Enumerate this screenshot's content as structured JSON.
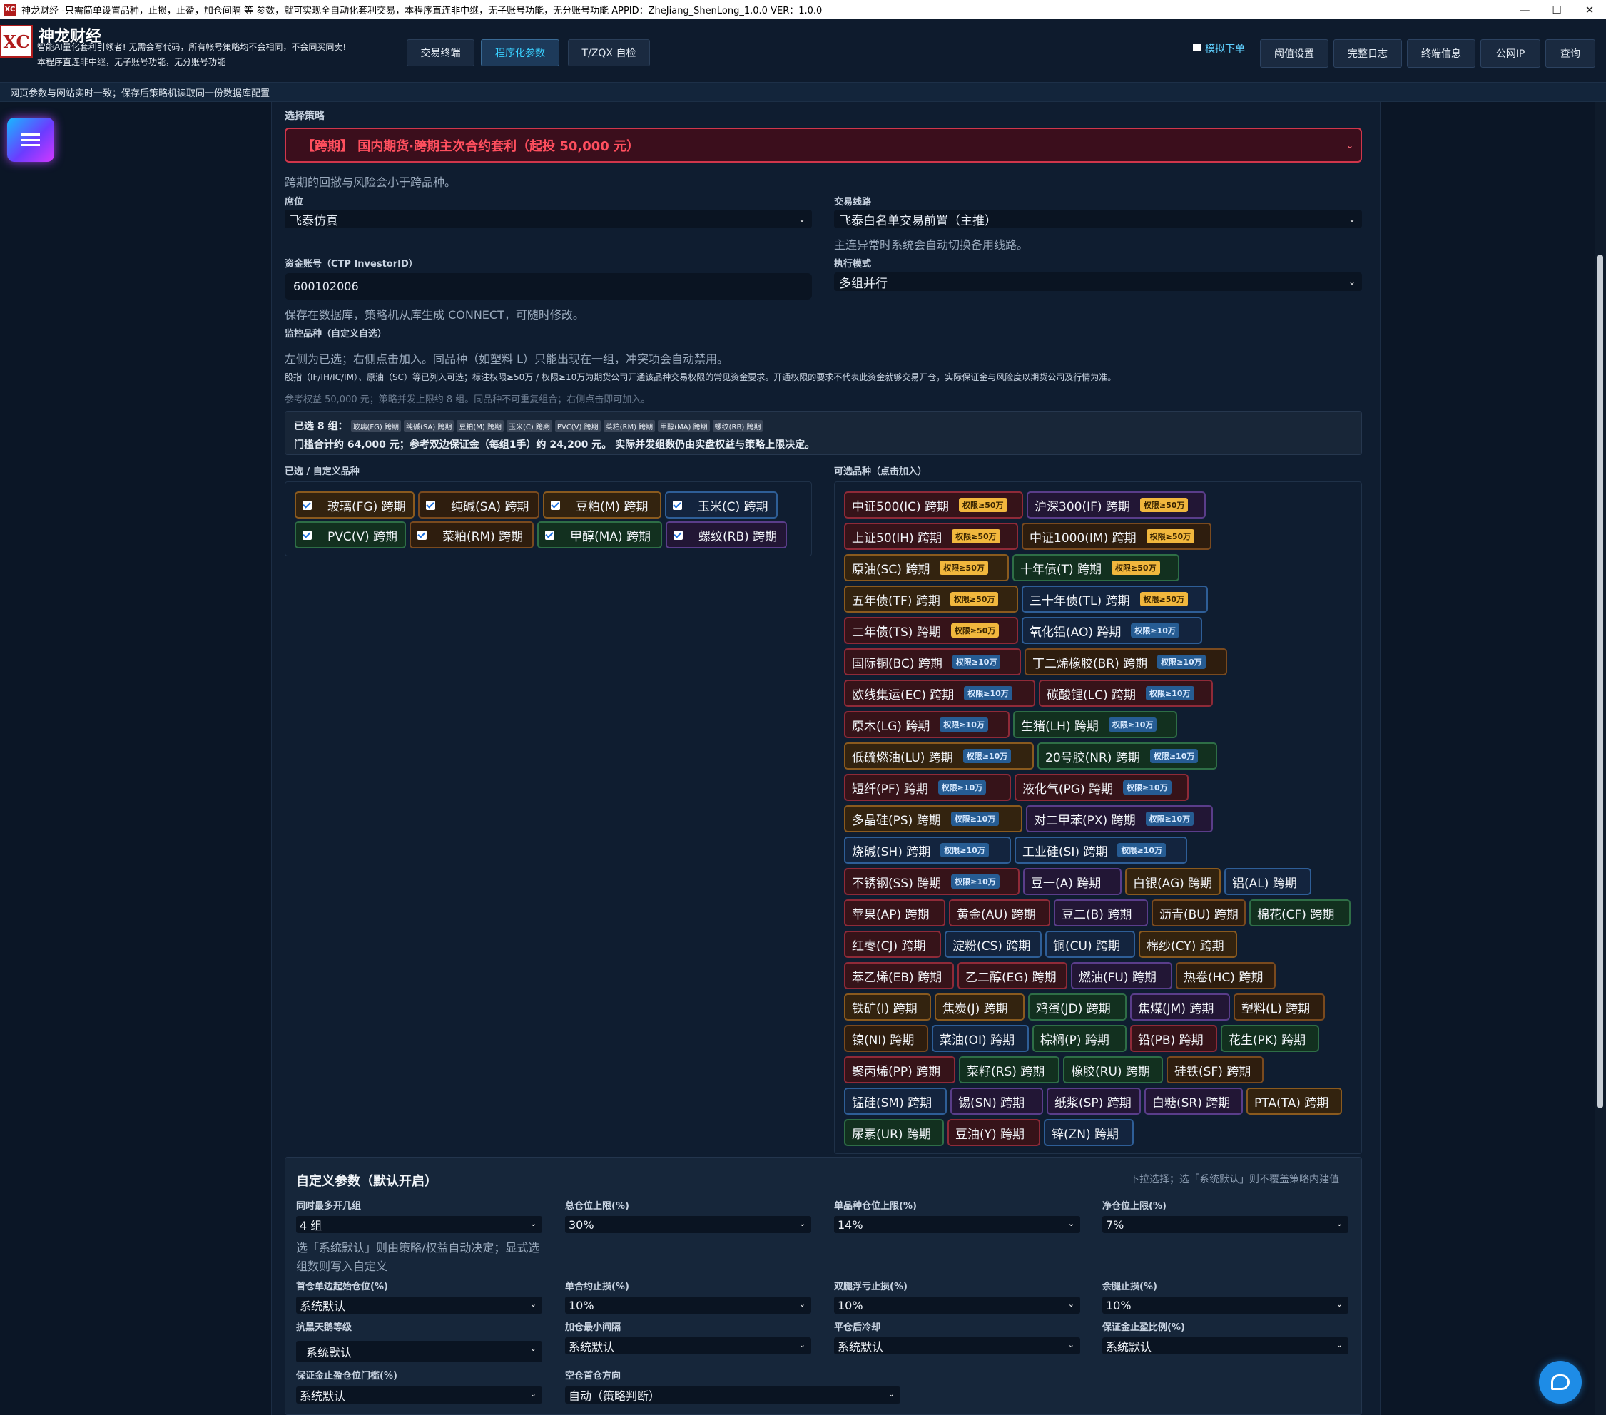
{
  "titlebar": {
    "logo": "XC",
    "text": "神龙财经 -只需简单设置品种，止损，止盈，加仓间隔 等 参数，就可实现全自动化套利交易，本程序直连非中继，无子账号功能，无分账号功能 APPID：ZheJiang_ShenLong_1.0.0  VER：1.0.0",
    "minimize": "—",
    "maximize": "☐",
    "close": "✕"
  },
  "header": {
    "brand_logo": "XC",
    "brand_name": "神龙财经",
    "brand_sub1": "智能AI量化套利引领者! 无需会写代码，所有帐号策略均不会相同，不会同买同卖!",
    "brand_sub2": "本程序直连非中继，无子账号功能，无分账号功能",
    "tabs": [
      "交易终端",
      "程序化参数",
      "T/ZQX 自检"
    ],
    "sim_label": "模拟下单",
    "buttons": [
      "阈值设置",
      "完整日志",
      "终端信息",
      "公网IP",
      "查询"
    ]
  },
  "notice": "网页参数与网站实时一致；保存后策略机读取同一份数据库配置",
  "strategy": {
    "label": "选择策略",
    "value": "【跨期】 国内期货·跨期主次合约套利（起投 50,000 元）",
    "hint": "跨期的回撤与风险会小于跨品种。"
  },
  "broker": {
    "label": "席位",
    "value": "飞泰仿真"
  },
  "route": {
    "label": "交易线路",
    "value": "飞泰白名单交易前置（主推）",
    "hint": "主连异常时系统会自动切换备用线路。"
  },
  "account": {
    "label": "资金账号（CTP InvestorID）",
    "value": "600102006",
    "hint": "保存在数据库，策略机从库生成 CONNECT，可随时修改。"
  },
  "exec_mode": {
    "label": "执行模式",
    "value": "多组并行"
  },
  "monitor": {
    "label": "监控品种（自定义自选）",
    "hint1": "左侧为已选；右侧点击加入。同品种（如塑料 L）只能出现在一组，冲突项会自动禁用。",
    "hint2": "股指（IF/IH/IC/IM）、原油（SC）等已列入可选；标注权限≥50万 / 权限≥10万为期货公司开通该品种交易权限的常见资金要求。开通权限的要求不代表此资金就够交易开仓，实际保证金与风险度以期货公司及行情为准。",
    "hint3": "参考权益 50,000 元；策略并发上限约 8 组。同品种不可重复组合；右侧点击即可加入。"
  },
  "summary": {
    "line1_prefix": "已选 8 组：",
    "tags": [
      "玻璃(FG) 跨期",
      "纯碱(SA) 跨期",
      "豆粕(M) 跨期",
      "玉米(C) 跨期",
      "PVC(V) 跨期",
      "菜粕(RM) 跨期",
      "甲醇(MA) 跨期",
      "螺纹(RB) 跨期"
    ],
    "line2": "门槛合计约 64,000 元；参考双边保证金（每组1手）约 24,200 元。 实际并发组数仍由实盘权益与策略上限决定。"
  },
  "selected": {
    "label": "已选 / 自定义品种",
    "items": [
      "玻璃(FG) 跨期",
      "纯碱(SA) 跨期",
      "豆粕(M) 跨期",
      "玉米(C) 跨期",
      "PVC(V) 跨期",
      "菜粕(RM) 跨期",
      "甲醇(MA) 跨期",
      "螺纹(RB) 跨期"
    ]
  },
  "available": {
    "label": "可选品种（点击加入）",
    "items": [
      {
        "text": "中证500(IC) 跨期",
        "badge": "权限≥50万"
      },
      {
        "text": "沪深300(IF) 跨期",
        "badge": "权限≥50万"
      },
      {
        "text": "上证50(IH) 跨期",
        "badge": "权限≥50万"
      },
      {
        "text": "中证1000(IM) 跨期",
        "badge": "权限≥50万"
      },
      {
        "text": "原油(SC) 跨期",
        "badge": "权限≥50万"
      },
      {
        "text": "十年债(T) 跨期",
        "badge": "权限≥50万"
      },
      {
        "text": "五年债(TF) 跨期",
        "badge": "权限≥50万"
      },
      {
        "text": "三十年债(TL) 跨期",
        "badge": "权限≥50万"
      },
      {
        "text": "二年债(TS) 跨期",
        "badge": "权限≥50万"
      },
      {
        "text": "氧化铝(AO) 跨期",
        "badge": "权限≥10万"
      },
      {
        "text": "国际铜(BC) 跨期",
        "badge": "权限≥10万"
      },
      {
        "text": "丁二烯橡胶(BR) 跨期",
        "badge": "权限≥10万"
      },
      {
        "text": "欧线集运(EC) 跨期",
        "badge": "权限≥10万"
      },
      {
        "text": "碳酸锂(LC) 跨期",
        "badge": "权限≥10万"
      },
      {
        "text": "原木(LG) 跨期",
        "badge": "权限≥10万"
      },
      {
        "text": "生猪(LH) 跨期",
        "badge": "权限≥10万"
      },
      {
        "text": "低硫燃油(LU) 跨期",
        "badge": "权限≥10万"
      },
      {
        "text": "20号胶(NR) 跨期",
        "badge": "权限≥10万"
      },
      {
        "text": "短纤(PF) 跨期",
        "badge": "权限≥10万"
      },
      {
        "text": "液化气(PG) 跨期",
        "badge": "权限≥10万"
      },
      {
        "text": "多晶硅(PS) 跨期",
        "badge": "权限≥10万"
      },
      {
        "text": "对二甲苯(PX) 跨期",
        "badge": "权限≥10万"
      },
      {
        "text": "烧碱(SH) 跨期",
        "badge": "权限≥10万"
      },
      {
        "text": "工业硅(SI) 跨期",
        "badge": "权限≥10万"
      },
      {
        "text": "不锈钢(SS) 跨期",
        "badge": "权限≥10万"
      },
      {
        "text": "豆一(A) 跨期",
        "badge": ""
      },
      {
        "text": "白银(AG) 跨期",
        "badge": ""
      },
      {
        "text": "铝(AL) 跨期",
        "badge": ""
      },
      {
        "text": "苹果(AP) 跨期",
        "badge": ""
      },
      {
        "text": "黄金(AU) 跨期",
        "badge": ""
      },
      {
        "text": "豆二(B) 跨期",
        "badge": ""
      },
      {
        "text": "沥青(BU) 跨期",
        "badge": ""
      },
      {
        "text": "棉花(CF) 跨期",
        "badge": ""
      },
      {
        "text": "红枣(CJ) 跨期",
        "badge": ""
      },
      {
        "text": "淀粉(CS) 跨期",
        "badge": ""
      },
      {
        "text": "铜(CU) 跨期",
        "badge": ""
      },
      {
        "text": "棉纱(CY) 跨期",
        "badge": ""
      },
      {
        "text": "苯乙烯(EB) 跨期",
        "badge": ""
      },
      {
        "text": "乙二醇(EG) 跨期",
        "badge": ""
      },
      {
        "text": "燃油(FU) 跨期",
        "badge": ""
      },
      {
        "text": "热卷(HC) 跨期",
        "badge": ""
      },
      {
        "text": "铁矿(I) 跨期",
        "badge": ""
      },
      {
        "text": "焦炭(J) 跨期",
        "badge": ""
      },
      {
        "text": "鸡蛋(JD) 跨期",
        "badge": ""
      },
      {
        "text": "焦煤(JM) 跨期",
        "badge": ""
      },
      {
        "text": "塑料(L) 跨期",
        "badge": ""
      },
      {
        "text": "镍(NI) 跨期",
        "badge": ""
      },
      {
        "text": "菜油(OI) 跨期",
        "badge": ""
      },
      {
        "text": "棕榈(P) 跨期",
        "badge": ""
      },
      {
        "text": "铅(PB) 跨期",
        "badge": ""
      },
      {
        "text": "花生(PK) 跨期",
        "badge": ""
      },
      {
        "text": "聚丙烯(PP) 跨期",
        "badge": ""
      },
      {
        "text": "菜籽(RS) 跨期",
        "badge": ""
      },
      {
        "text": "橡胶(RU) 跨期",
        "badge": ""
      },
      {
        "text": "硅铁(SF) 跨期",
        "badge": ""
      },
      {
        "text": "锰硅(SM) 跨期",
        "badge": ""
      },
      {
        "text": "锡(SN) 跨期",
        "badge": ""
      },
      {
        "text": "纸浆(SP) 跨期",
        "badge": ""
      },
      {
        "text": "白糖(SR) 跨期",
        "badge": ""
      },
      {
        "text": "PTA(TA) 跨期",
        "badge": ""
      },
      {
        "text": "尿素(UR) 跨期",
        "badge": ""
      },
      {
        "text": "豆油(Y) 跨期",
        "badge": ""
      },
      {
        "text": "锌(ZN) 跨期",
        "badge": ""
      }
    ]
  },
  "custom": {
    "title": "自定义参数（默认开启）",
    "note": "下拉选择；选「系统默认」则不覆盖策略内建值",
    "group_hint": "选「系统默认」则由策略/权益自动决定；显式选组数则写入自定义",
    "params": [
      {
        "label": "同时最多开几组",
        "value": "4 组"
      },
      {
        "label": "总仓位上限(%)",
        "value": "30%"
      },
      {
        "label": "单品种仓位上限(%)",
        "value": "14%"
      },
      {
        "label": "净仓位上限(%)",
        "value": "7%"
      },
      {
        "label": "首仓单边起始仓位(%)",
        "value": "系统默认"
      },
      {
        "label": "单合约止损(%)",
        "value": "10%"
      },
      {
        "label": "双腿浮亏止损(%)",
        "value": "10%"
      },
      {
        "label": "余腿止损(%)",
        "value": "10%"
      },
      {
        "label": "抗黑天鹅等级",
        "value": "系统默认"
      },
      {
        "label": "加仓最小间隔",
        "value": "系统默认"
      },
      {
        "label": "平仓后冷却",
        "value": "系统默认"
      },
      {
        "label": "保证金止盈比例(%)",
        "value": "系统默认"
      },
      {
        "label": "保证金止盈仓位门槛(%)",
        "value": "系统默认"
      },
      {
        "label": "空仓首仓方向",
        "value": "自动（策略判断）"
      }
    ]
  },
  "colors": {
    "accent": "#39d0ff",
    "danger": "#d0364b",
    "badge_50": "#f1b73d",
    "badge_10": "#265c93"
  }
}
